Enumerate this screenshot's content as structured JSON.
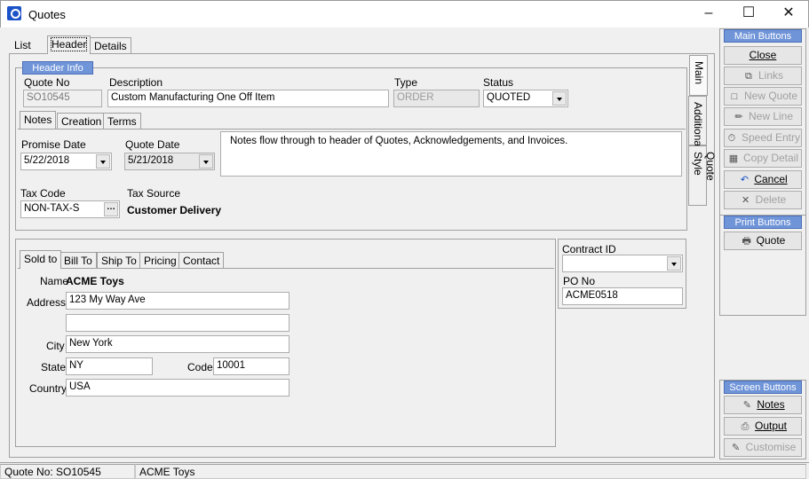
{
  "window": {
    "title": "Quotes"
  },
  "tabs": {
    "list": "List",
    "header": "Header",
    "details": "Details"
  },
  "header_info": {
    "group_title": "Header Info",
    "quote_no_label": "Quote No",
    "quote_no": "SO10545",
    "description_label": "Description",
    "description": "Custom Manufacturing One Off Item",
    "type_label": "Type",
    "type": "ORDER",
    "status_label": "Status",
    "status": "QUOTED"
  },
  "subtabs": {
    "notes": "Notes",
    "creation": "Creation",
    "terms": "Terms"
  },
  "dates": {
    "promise_label": "Promise Date",
    "promise": "5/22/2018",
    "quote_label": "Quote Date",
    "quote": "5/21/2018"
  },
  "notes_text": "Notes flow through to header of Quotes, Acknowledgements, and Invoices.",
  "tax": {
    "code_label": "Tax Code",
    "code": "NON-TAX-S",
    "source_label": "Tax Source",
    "source": "Customer Delivery"
  },
  "side_tabs": {
    "main": "Main",
    "additional": "Additional",
    "quote_style": "Quote Style"
  },
  "address_tabs": {
    "sold_to": "Sold to",
    "bill_to": "Bill To",
    "ship_to": "Ship To",
    "pricing": "Pricing",
    "contact": "Contact"
  },
  "sold_to": {
    "name_label": "Name",
    "name": "ACME Toys",
    "address_label": "Address",
    "address1": "123 My Way Ave",
    "address2": "",
    "city_label": "City",
    "city": "New York",
    "state_label": "State",
    "state": "NY",
    "code_label": "Code",
    "code": "10001",
    "country_label": "Country",
    "country": "USA"
  },
  "contract": {
    "contract_id_label": "Contract ID",
    "contract_id": "",
    "po_no_label": "PO No",
    "po_no": "ACME0518"
  },
  "main_buttons": {
    "title": "Main Buttons",
    "close": "Close",
    "links": "Links",
    "new_quote": "New Quote",
    "new_line": "New Line",
    "speed_entry": "Speed Entry",
    "copy_detail": "Copy Detail",
    "cancel": "Cancel",
    "delete": "Delete"
  },
  "print_buttons": {
    "title": "Print Buttons",
    "quote": "Quote"
  },
  "screen_buttons": {
    "title": "Screen Buttons",
    "notes": "Notes",
    "output": "Output",
    "customise": "Customise"
  },
  "statusbar": {
    "quote_no": "Quote No: SO10545",
    "customer": "ACME Toys"
  }
}
